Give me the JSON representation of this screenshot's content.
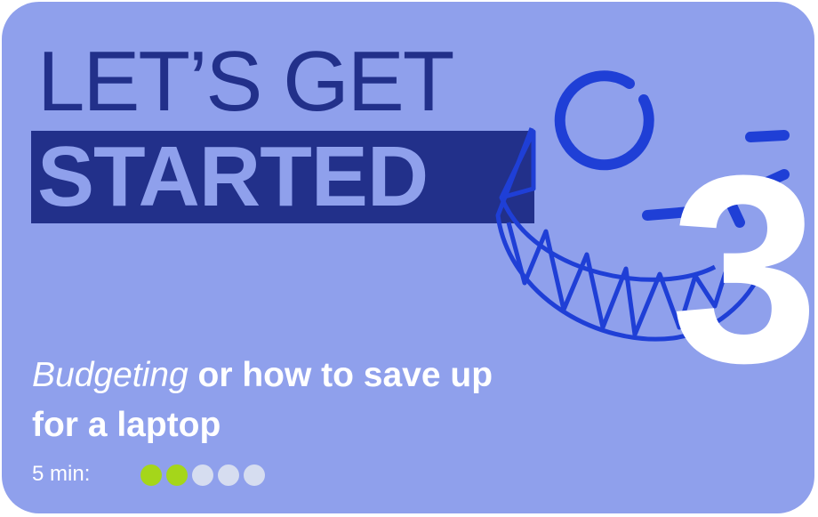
{
  "card": {
    "headline_line1": "LET’S GET",
    "headline_line2": "STARTED",
    "lesson_number": "3",
    "title_emphasis": "Budgeting",
    "title_rest": " or how to save up for a laptop",
    "duration_label": "5 min:",
    "difficulty": {
      "filled": 2,
      "total": 5
    }
  },
  "colors": {
    "background": "#8fa0ec",
    "headline": "#22308a",
    "illustration_stroke": "#1f3fd6",
    "dot_filled": "#a5d61a",
    "dot_empty": "#d6ddf0",
    "text": "#ffffff"
  },
  "icons": {
    "illustration": "smiley-face-icon"
  }
}
